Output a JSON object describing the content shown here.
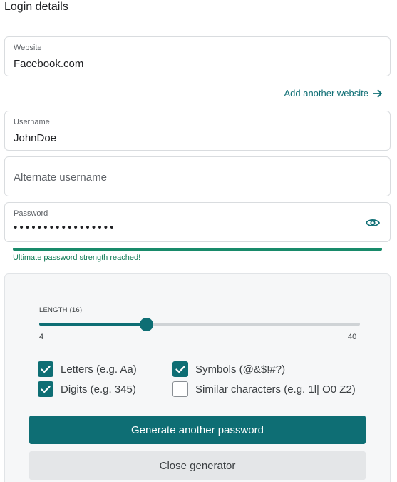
{
  "page": {
    "title": "Login details"
  },
  "website": {
    "label": "Website",
    "value": "Facebook.com"
  },
  "add_website": {
    "label": "Add another website",
    "icon": "arrow-right-icon"
  },
  "username": {
    "label": "Username",
    "value": "JohnDoe"
  },
  "alternate_username": {
    "placeholder": "Alternate username"
  },
  "password": {
    "label": "Password",
    "masked_value": "•••••••••••••••••",
    "toggle_icon": "eye-icon"
  },
  "strength": {
    "message": "Ultimate password strength reached!",
    "color": "#188a6a"
  },
  "generator": {
    "length_label": "LENGTH (16)",
    "length": {
      "min": 4,
      "max": 40,
      "value": 16,
      "min_label": "4",
      "max_label": "40"
    },
    "options": [
      {
        "label": "Letters (e.g. Aa)",
        "checked": true
      },
      {
        "label": "Symbols (@&$!#?)",
        "checked": true
      },
      {
        "label": "Digits (e.g. 345)",
        "checked": true
      },
      {
        "label": "Similar characters (e.g. 1l| O0 Z2)",
        "checked": false
      }
    ],
    "generate_label": "Generate another password",
    "close_label": "Close generator"
  },
  "colors": {
    "accent": "#0e6e74",
    "success": "#107a55"
  }
}
